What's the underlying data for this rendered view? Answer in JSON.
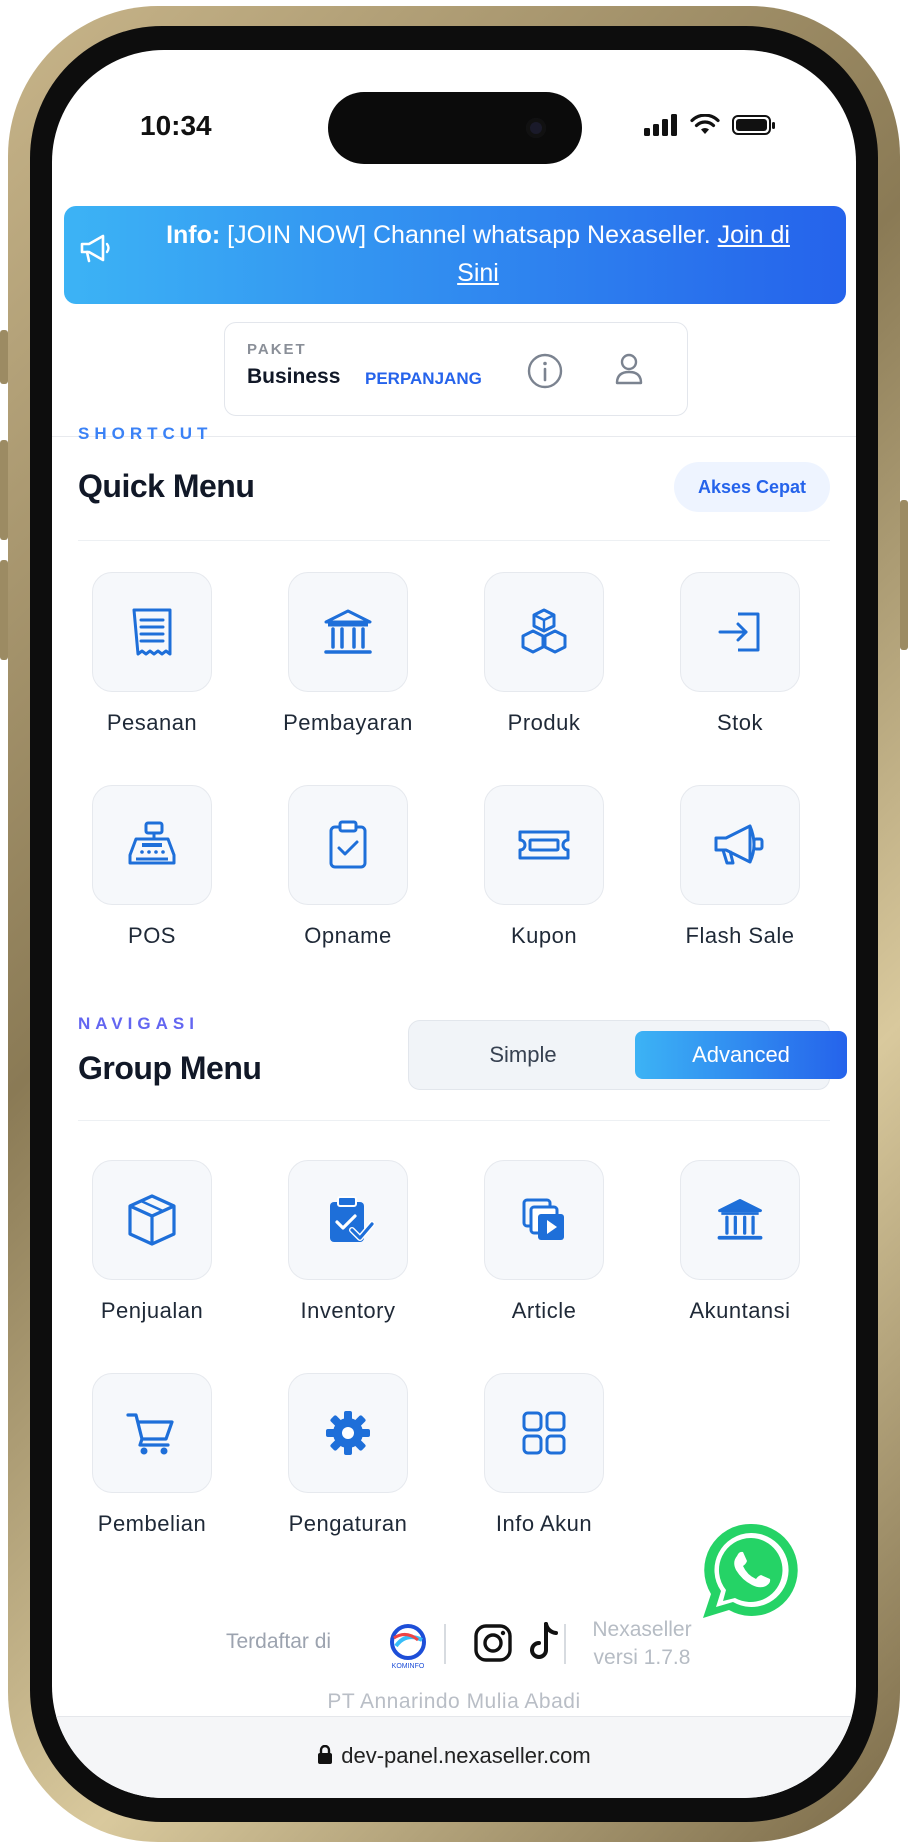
{
  "status_bar": {
    "time": "10:34"
  },
  "banner": {
    "prefix": "Info:",
    "message": "[JOIN NOW] Channel whatsapp Nexaseller.",
    "link_part1": "Join di",
    "link_part2": "Sini",
    "colors": {
      "from": "#3cb3f5",
      "to": "#2563eb"
    }
  },
  "paket": {
    "label": "PAKET",
    "plan": "Business",
    "action": "PERPANJANG",
    "icons": [
      "info-circle-icon",
      "user-icon"
    ]
  },
  "quick_menu": {
    "eyebrow": "SHORTCUT",
    "title": "Quick Menu",
    "pill": "Akses Cepat",
    "items": [
      {
        "label": "Pesanan",
        "icon": "receipt-icon"
      },
      {
        "label": "Pembayaran",
        "icon": "bank-icon"
      },
      {
        "label": "Produk",
        "icon": "boxes-icon"
      },
      {
        "label": "Stok",
        "icon": "sign-in-icon"
      },
      {
        "label": "POS",
        "icon": "cash-register-icon"
      },
      {
        "label": "Opname",
        "icon": "clipboard-check-icon"
      },
      {
        "label": "Kupon",
        "icon": "ticket-icon"
      },
      {
        "label": "Flash Sale",
        "icon": "megaphone-icon"
      }
    ]
  },
  "group_menu": {
    "eyebrow": "NAVIGASI",
    "title": "Group Menu",
    "toggle": {
      "options": [
        "Simple",
        "Advanced"
      ],
      "selected": "Advanced"
    },
    "items": [
      {
        "label": "Penjualan",
        "icon": "package-icon"
      },
      {
        "label": "Inventory",
        "icon": "clipboard-check-filled-icon"
      },
      {
        "label": "Article",
        "icon": "media-library-icon"
      },
      {
        "label": "Akuntansi",
        "icon": "bank-icon"
      },
      {
        "label": "Pembelian",
        "icon": "cart-icon"
      },
      {
        "label": "Pengaturan",
        "icon": "gear-icon"
      },
      {
        "label": "Info Akun",
        "icon": "grid-icon"
      }
    ]
  },
  "footer": {
    "registered": "Terdaftar di",
    "kominfo_text": "KOMINFO",
    "version_line1": "Nexaseller",
    "version_line2": "versi 1.7.8",
    "company": "PT Annarindo Mulia Abadi"
  },
  "browser": {
    "url": "dev-panel.nexaseller.com"
  },
  "theme": {
    "accent": "#2563eb",
    "icon_blue": "#1e6fd9",
    "whatsapp": "#25d366"
  }
}
